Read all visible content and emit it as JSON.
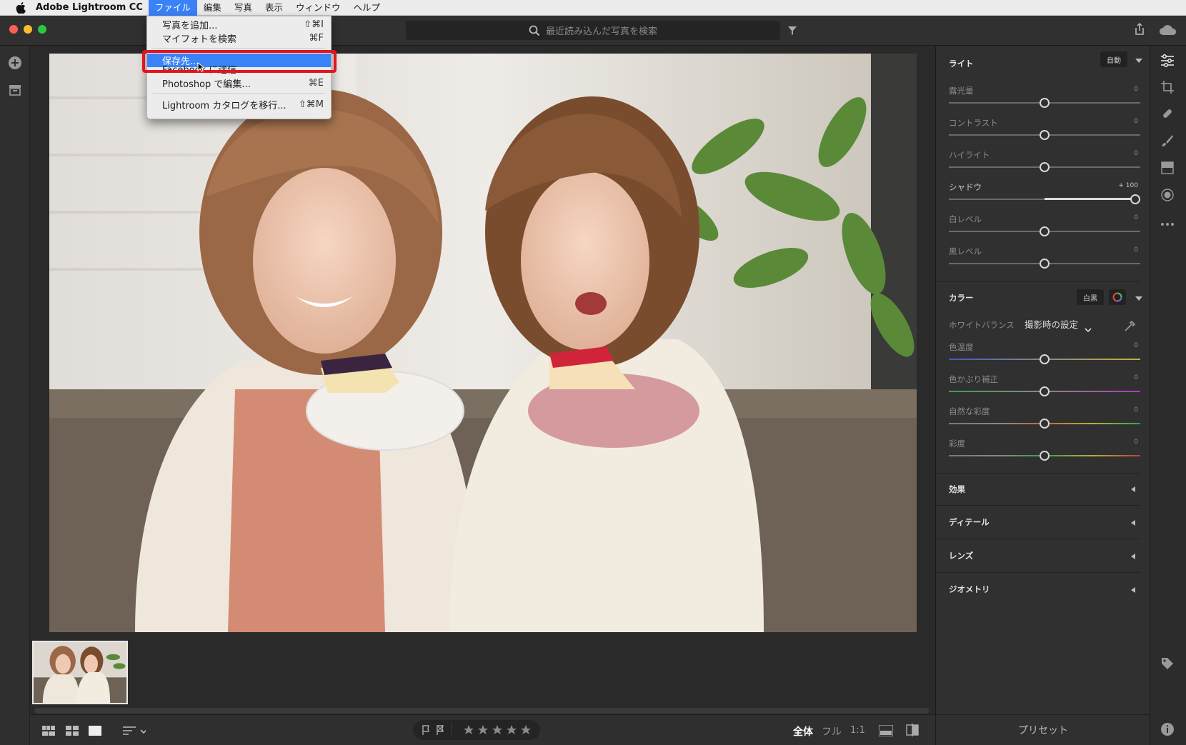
{
  "menubar": {
    "app_name": "Adobe Lightroom CC",
    "items": [
      "ファイル",
      "編集",
      "写真",
      "表示",
      "ウィンドウ",
      "ヘルプ"
    ],
    "active_index": 0
  },
  "search": {
    "placeholder": "最近読み込んだ写真を検索"
  },
  "file_menu": {
    "items": [
      {
        "label": "写真を追加...",
        "shortcut": "⇧⌘I"
      },
      {
        "label": "マイフォトを検索",
        "shortcut": "⌘F"
      },
      {
        "label": "保存先...",
        "shortcut": "",
        "highlighted": true
      },
      {
        "label": "Facebook に送信...",
        "shortcut": ""
      },
      {
        "label": "Photoshop で編集...",
        "shortcut": "⌘E"
      },
      {
        "label": "Lightroom カタログを移行...",
        "shortcut": "⇧⌘M"
      }
    ]
  },
  "light": {
    "title": "ライト",
    "auto_label": "自動",
    "sliders": [
      {
        "label": "露光量",
        "value": "0",
        "position": 0.5
      },
      {
        "label": "コントラスト",
        "value": "0",
        "position": 0.5
      },
      {
        "label": "ハイライト",
        "value": "0",
        "position": 0.5
      },
      {
        "label": "シャドウ",
        "value": "+ 100",
        "position": 1.0
      },
      {
        "label": "白レベル",
        "value": "0",
        "position": 0.5
      },
      {
        "label": "黒レベル",
        "value": "0",
        "position": 0.5
      }
    ]
  },
  "color": {
    "title": "カラー",
    "bw_label": "白黒",
    "wb_label": "ホワイトバランス",
    "wb_value": "撮影時の設定",
    "sliders": [
      {
        "label": "色温度",
        "value": "0",
        "position": 0.5
      },
      {
        "label": "色かぶり補正",
        "value": "0",
        "position": 0.5
      },
      {
        "label": "自然な彩度",
        "value": "0",
        "position": 0.5
      },
      {
        "label": "彩度",
        "value": "0",
        "position": 0.5
      }
    ]
  },
  "collapsed_sections": [
    "効果",
    "ディテール",
    "レンズ",
    "ジオメトリ"
  ],
  "bottom": {
    "zoom_fit": "全体",
    "zoom_fill": "フル",
    "zoom_one": "1:1",
    "presets": "プリセット"
  },
  "colors": {
    "accent": "#3a82f7",
    "highlight_box": "#e4141a",
    "panel_bg": "#303030"
  }
}
